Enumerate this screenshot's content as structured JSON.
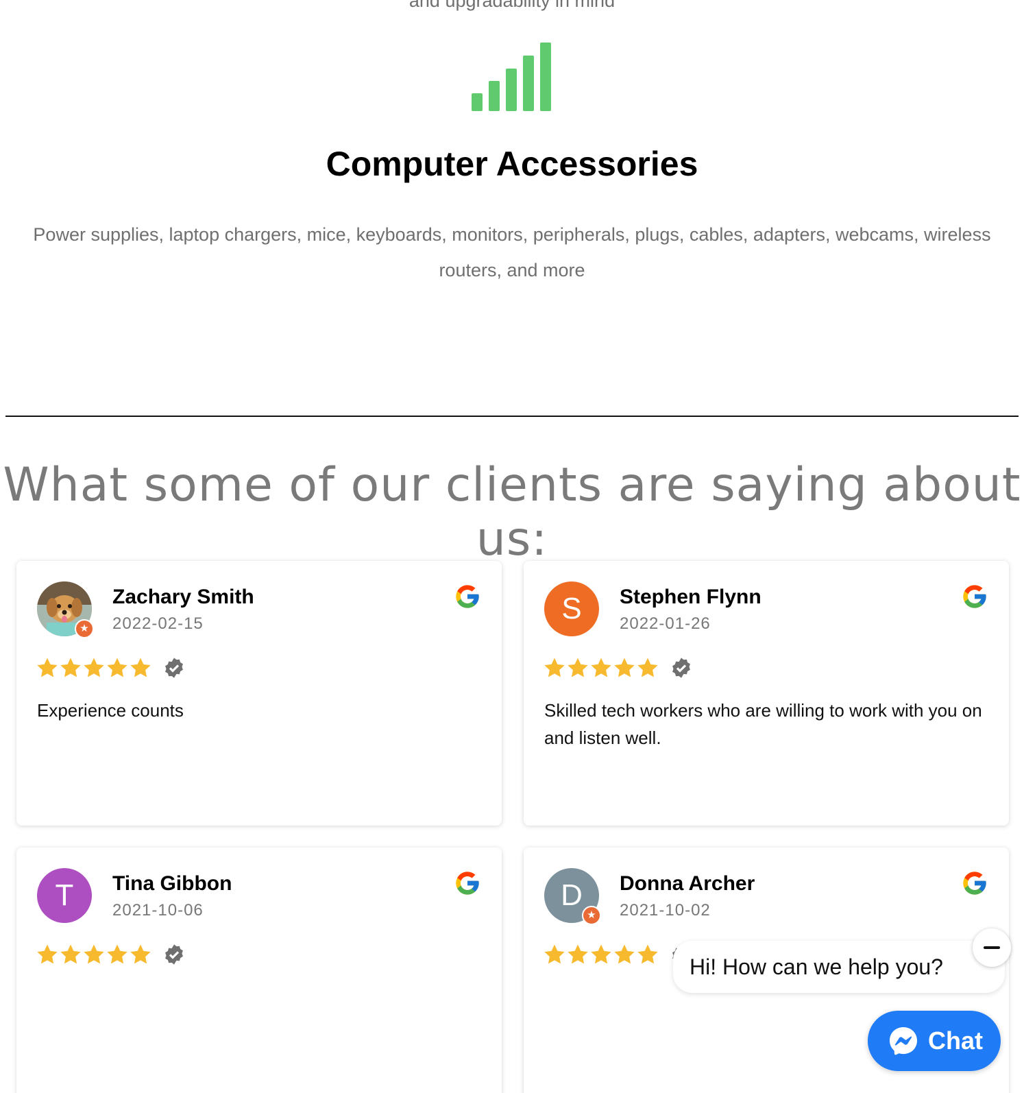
{
  "services": {
    "cut_text": "and upgradability in mind",
    "item": {
      "icon": "signal-bars-icon",
      "title": "Computer Accessories",
      "description": "Power supplies, laptop chargers, mice, keyboards, monitors, peripherals, plugs, cables, adapters, webcams, wireless routers, and more"
    },
    "accent_color": "#5fcb6e"
  },
  "reviews": {
    "heading": "What some of our clients are saying about us:",
    "star_color": "#f7b92e",
    "items": [
      {
        "name": "Zachary Smith",
        "date": "2022-02-15",
        "rating": 5,
        "text": "Experience counts",
        "avatar_type": "photo",
        "source": "google-icon"
      },
      {
        "name": "Stephen Flynn",
        "date": "2022-01-26",
        "rating": 5,
        "text": "Skilled tech workers who are willing to work with you on and listen well.",
        "avatar_letter": "S",
        "avatar_color": "#ef6c24",
        "source": "google-icon"
      },
      {
        "name": "Tina Gibbon",
        "date": "2021-10-06",
        "rating": 5,
        "text": "",
        "avatar_letter": "T",
        "avatar_color": "#ad4fc0",
        "source": "google-icon"
      },
      {
        "name": "Donna Archer",
        "date": "2021-10-02",
        "rating": 5,
        "text": "",
        "avatar_letter": "D",
        "avatar_color": "#7d919c",
        "source": "google-icon"
      }
    ]
  },
  "chat": {
    "greeting": "Hi! How can we help you?",
    "button_label": "Chat",
    "button_color": "#1f7cf6",
    "icon": "messenger-icon"
  }
}
